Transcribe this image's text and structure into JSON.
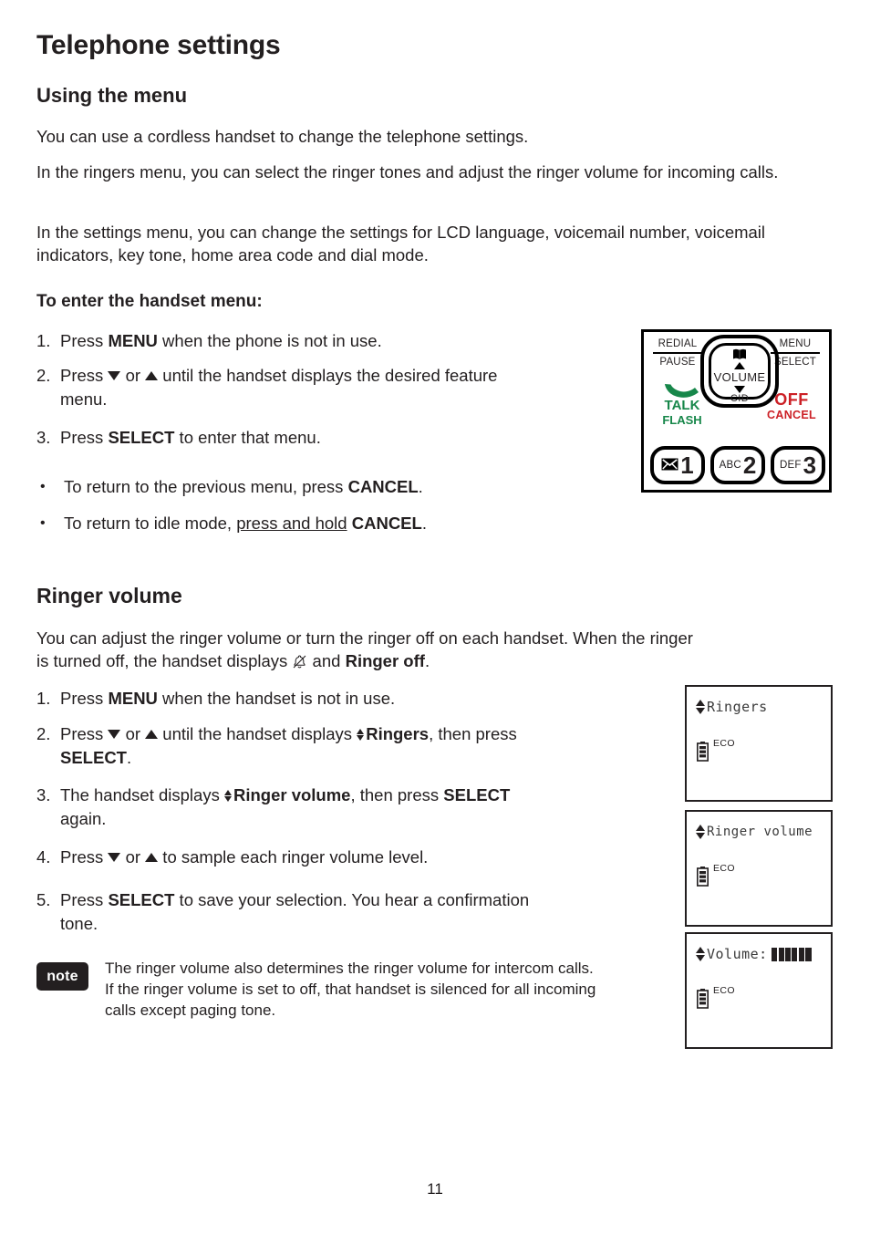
{
  "document": {
    "title": "Telephone settings",
    "page_number": "11"
  },
  "using_the_menu": {
    "heading": "Using the menu",
    "paragraphs": [
      "You can use a cordless handset to change the telephone settings.",
      "In the ringers menu, you can select the ringer tones and adjust the ringer volume for incoming calls.",
      "In the settings menu, you can change the settings for LCD language, voicemail number, voicemail indicators, key tone, home area code and dial mode."
    ],
    "subheading": "To enter the handset menu:",
    "steps": [
      {
        "marker": "1.",
        "parts": [
          {
            "text": "Press ",
            "style": "normal"
          },
          {
            "text": "MENU",
            "style": "bold"
          },
          {
            "text": " when the phone is not in use.",
            "style": "normal"
          }
        ]
      },
      {
        "marker": "2.",
        "parts": [
          {
            "text": "Press ",
            "style": "normal"
          },
          {
            "text": "",
            "style": "tri-down"
          },
          {
            "text": " or ",
            "style": "normal"
          },
          {
            "text": "",
            "style": "tri-up"
          },
          {
            "text": " until the handset displays the desired feature menu.",
            "style": "normal"
          }
        ]
      },
      {
        "marker": "3.",
        "parts": [
          {
            "text": "Press ",
            "style": "normal"
          },
          {
            "text": "SELECT",
            "style": "bold"
          },
          {
            "text": " to enter that menu.",
            "style": "normal"
          }
        ]
      }
    ],
    "bullets": [
      {
        "marker": "•",
        "parts": [
          {
            "text": "To return to the previous menu, press ",
            "style": "normal"
          },
          {
            "text": "CANCEL",
            "style": "bold"
          },
          {
            "text": ".",
            "style": "normal"
          }
        ]
      },
      {
        "marker": "•",
        "parts": [
          {
            "text": "To return to idle mode, ",
            "style": "normal"
          },
          {
            "text": "press and hold",
            "style": "underline"
          },
          {
            "text": " ",
            "style": "normal"
          },
          {
            "text": "CANCEL",
            "style": "bold"
          },
          {
            "text": ".",
            "style": "normal"
          }
        ]
      }
    ]
  },
  "ringer_volume": {
    "heading": "Ringer volume",
    "intro_parts": [
      {
        "text": "You can adjust the ringer volume or turn the ringer off on each handset. When the ringer is turned off, the handset displays ",
        "style": "normal"
      },
      {
        "text": "",
        "style": "bell-off-icon"
      },
      {
        "text": " and ",
        "style": "normal"
      },
      {
        "text": "Ringer off",
        "style": "bold"
      },
      {
        "text": ".",
        "style": "normal"
      }
    ],
    "steps": [
      {
        "marker": "1.",
        "parts": [
          {
            "text": "Press ",
            "style": "normal"
          },
          {
            "text": "MENU",
            "style": "bold"
          },
          {
            "text": " when the handset is not in use.",
            "style": "normal"
          }
        ]
      },
      {
        "marker": "2.",
        "parts": [
          {
            "text": "Press ",
            "style": "normal"
          },
          {
            "text": "",
            "style": "tri-down"
          },
          {
            "text": " or ",
            "style": "normal"
          },
          {
            "text": "",
            "style": "tri-up"
          },
          {
            "text": " until the handset displays ",
            "style": "normal"
          },
          {
            "text": "",
            "style": "updown"
          },
          {
            "text": "Ringers",
            "style": "bold"
          },
          {
            "text": ", then press ",
            "style": "normal"
          },
          {
            "text": "SELECT",
            "style": "bold"
          },
          {
            "text": ".",
            "style": "normal"
          }
        ]
      },
      {
        "marker": "3.",
        "parts": [
          {
            "text": "The handset displays ",
            "style": "normal"
          },
          {
            "text": "",
            "style": "updown"
          },
          {
            "text": "Ringer volume",
            "style": "bold"
          },
          {
            "text": ", then press ",
            "style": "normal"
          },
          {
            "text": "SELECT",
            "style": "bold"
          },
          {
            "text": " again.",
            "style": "normal"
          }
        ]
      },
      {
        "marker": "4.",
        "parts": [
          {
            "text": "Press ",
            "style": "normal"
          },
          {
            "text": "",
            "style": "tri-down"
          },
          {
            "text": " or ",
            "style": "normal"
          },
          {
            "text": "",
            "style": "tri-up"
          },
          {
            "text": " to sample each ringer volume level.",
            "style": "normal"
          }
        ]
      },
      {
        "marker": "5.",
        "parts": [
          {
            "text": "Press ",
            "style": "normal"
          },
          {
            "text": "SELECT",
            "style": "bold"
          },
          {
            "text": " to save your selection. You hear a confirmation tone.",
            "style": "normal"
          }
        ]
      }
    ],
    "note": {
      "badge": "note",
      "text": "The ringer volume also determines the ringer volume for intercom calls. If the ringer volume is set to off, that handset is silenced for all incoming calls except paging tone."
    }
  },
  "keypad_illustration": {
    "redial_label": "REDIAL",
    "pause_label": "PAUSE",
    "menu_label": "MENU",
    "select_label": "SELECT",
    "talk_label": "TALK",
    "flash_label": "FLASH",
    "off_label": "OFF",
    "cancel_label": "CANCEL",
    "volume_label": "VOLUME",
    "cid_label": "CID",
    "keys": [
      {
        "sub": "",
        "digit": "1",
        "icon": "envelope-icon"
      },
      {
        "sub": "ABC",
        "digit": "2",
        "icon": ""
      },
      {
        "sub": "DEF",
        "digit": "3",
        "icon": ""
      }
    ],
    "colors": {
      "talk_green": "#17874a",
      "off_red": "#cc2026",
      "outline": "#000000"
    }
  },
  "lcd_screens": [
    {
      "name": "ringers-screen",
      "title": "Ringers",
      "has_volume_bar": false,
      "eco_label": "ECO",
      "battery": "battery-icon"
    },
    {
      "name": "ringer-volume-screen",
      "title": "Ringer volume",
      "has_volume_bar": false,
      "eco_label": "ECO",
      "battery": "battery-icon"
    },
    {
      "name": "volume-level-screen",
      "title": "Volume:",
      "has_volume_bar": true,
      "volume_segments": 6,
      "eco_label": "ECO",
      "battery": "battery-icon"
    }
  ]
}
